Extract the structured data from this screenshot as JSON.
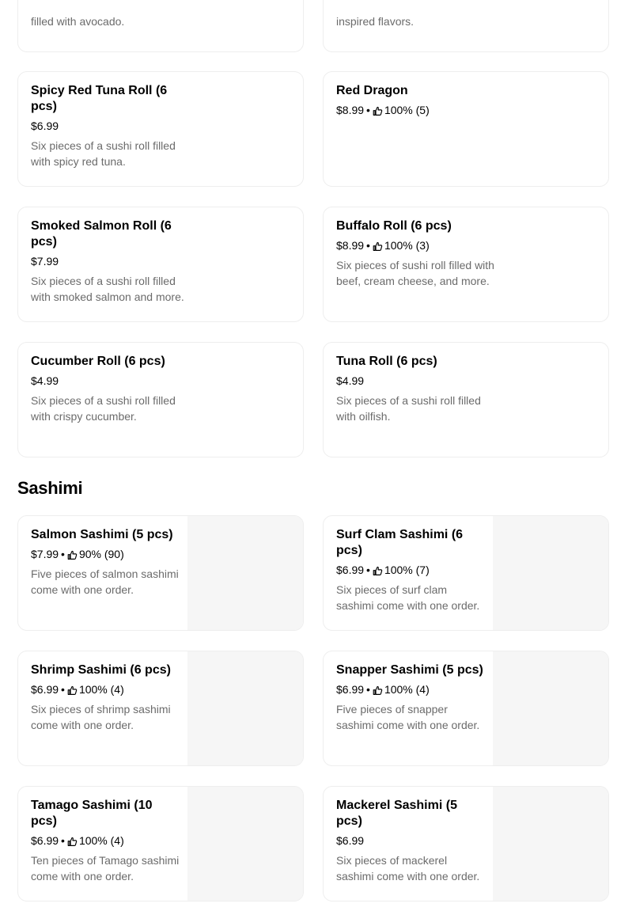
{
  "partial_cards": [
    {
      "desc_tail": "filled with avocado."
    },
    {
      "desc_tail": "inspired flavors."
    }
  ],
  "rolls": [
    {
      "title": "Spicy Red Tuna Roll (6 pcs)",
      "price": "$6.99",
      "rating": "",
      "desc": "Six pieces of a sushi roll filled with spicy red tuna."
    },
    {
      "title": "Red Dragon",
      "price": "$8.99",
      "rating": "100% (5)",
      "desc": ""
    },
    {
      "title": "Smoked Salmon Roll (6 pcs)",
      "price": "$7.99",
      "rating": "",
      "desc": "Six pieces of a sushi roll filled with smoked salmon and more."
    },
    {
      "title": "Buffalo Roll (6 pcs)",
      "price": "$8.99",
      "rating": "100% (3)",
      "desc": "Six pieces of sushi roll filled with beef, cream cheese, and more."
    },
    {
      "title": "Cucumber Roll (6 pcs)",
      "price": "$4.99",
      "rating": "",
      "desc": "Six pieces of a sushi roll filled with crispy cucumber."
    },
    {
      "title": "Tuna Roll (6 pcs)",
      "price": "$4.99",
      "rating": "",
      "desc": "Six pieces of a sushi roll filled with oilfish."
    }
  ],
  "sashimi_section": {
    "heading": "Sashimi"
  },
  "sashimi": [
    {
      "title": "Salmon Sashimi (5 pcs)",
      "price": "$7.99",
      "rating": "90% (90)",
      "desc": "Five pieces of salmon sashimi come with one order."
    },
    {
      "title": "Surf Clam Sashimi (6 pcs)",
      "price": "$6.99",
      "rating": "100% (7)",
      "desc": "Six pieces of surf clam sashimi come with one order."
    },
    {
      "title": "Shrimp Sashimi (6 pcs)",
      "price": "$6.99",
      "rating": "100% (4)",
      "desc": "Six pieces of shrimp sashimi come with one order."
    },
    {
      "title": "Snapper Sashimi (5 pcs)",
      "price": "$6.99",
      "rating": "100% (4)",
      "desc": "Five pieces of snapper sashimi come with one order."
    },
    {
      "title": "Tamago Sashimi (10 pcs)",
      "price": "$6.99",
      "rating": "100% (4)",
      "desc": "Ten pieces of Tamago sashimi come with one order."
    },
    {
      "title": "Mackerel Sashimi (5 pcs)",
      "price": "$6.99",
      "rating": "",
      "desc": "Six pieces of mackerel sashimi come with one order."
    }
  ],
  "icons": {
    "rating": "thumbs-up-icon"
  },
  "colors": {
    "text": "#000000",
    "muted": "#6b6b6b",
    "border": "#eeeeee",
    "image_placeholder": "#f6f6f6"
  }
}
